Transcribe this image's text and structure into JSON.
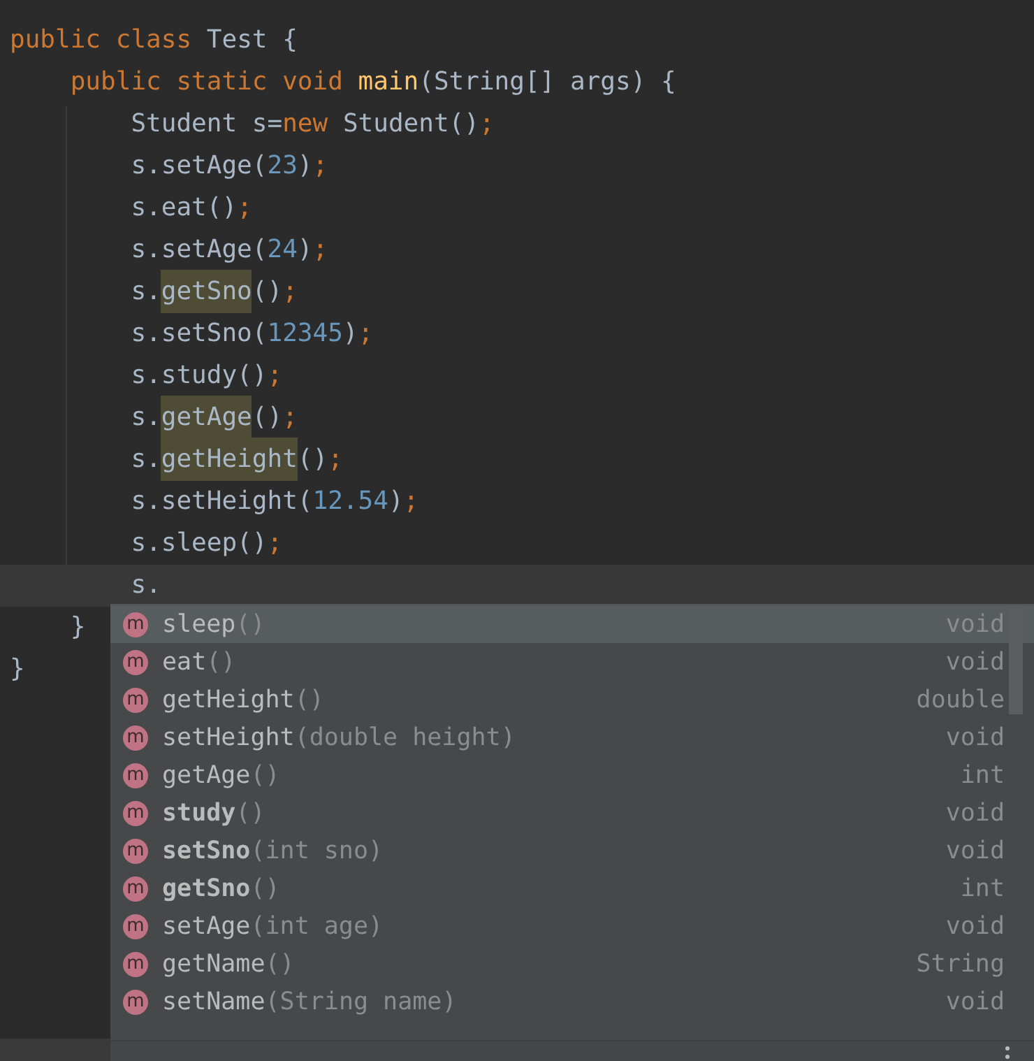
{
  "code_lines": [
    {
      "current": false,
      "tokens": [
        {
          "text": "public class ",
          "kind": "keyword"
        },
        {
          "text": "Test {",
          "kind": "plain"
        }
      ]
    },
    {
      "current": false,
      "tokens": [
        {
          "text": "    public static void ",
          "kind": "keyword"
        },
        {
          "text": "main",
          "kind": "declaration"
        },
        {
          "text": "(String[] args) {",
          "kind": "plain"
        }
      ]
    },
    {
      "current": false,
      "tokens": [
        {
          "text": "        Student s=",
          "kind": "plain"
        },
        {
          "text": "new ",
          "kind": "keyword"
        },
        {
          "text": "Student()",
          "kind": "plain"
        },
        {
          "text": ";",
          "kind": "keyword"
        }
      ]
    },
    {
      "current": false,
      "tokens": [
        {
          "text": "        s.setAge(",
          "kind": "plain"
        },
        {
          "text": "23",
          "kind": "number"
        },
        {
          "text": ")",
          "kind": "plain"
        },
        {
          "text": ";",
          "kind": "keyword"
        }
      ]
    },
    {
      "current": false,
      "tokens": [
        {
          "text": "        s.eat()",
          "kind": "plain"
        },
        {
          "text": ";",
          "kind": "keyword"
        }
      ]
    },
    {
      "current": false,
      "tokens": [
        {
          "text": "        s.setAge(",
          "kind": "plain"
        },
        {
          "text": "24",
          "kind": "number"
        },
        {
          "text": ")",
          "kind": "plain"
        },
        {
          "text": ";",
          "kind": "keyword"
        }
      ]
    },
    {
      "current": false,
      "tokens": [
        {
          "text": "        s.",
          "kind": "plain"
        },
        {
          "text": "getSno",
          "kind": "usage"
        },
        {
          "text": "()",
          "kind": "plain"
        },
        {
          "text": ";",
          "kind": "keyword"
        }
      ]
    },
    {
      "current": false,
      "tokens": [
        {
          "text": "        s.setSno(",
          "kind": "plain"
        },
        {
          "text": "12345",
          "kind": "number"
        },
        {
          "text": ")",
          "kind": "plain"
        },
        {
          "text": ";",
          "kind": "keyword"
        }
      ]
    },
    {
      "current": false,
      "tokens": [
        {
          "text": "        s.study()",
          "kind": "plain"
        },
        {
          "text": ";",
          "kind": "keyword"
        }
      ]
    },
    {
      "current": false,
      "tokens": [
        {
          "text": "        s.",
          "kind": "plain"
        },
        {
          "text": "getAge",
          "kind": "usage"
        },
        {
          "text": "()",
          "kind": "plain"
        },
        {
          "text": ";",
          "kind": "keyword"
        }
      ]
    },
    {
      "current": false,
      "tokens": [
        {
          "text": "        s.",
          "kind": "plain"
        },
        {
          "text": "getHeight",
          "kind": "usage"
        },
        {
          "text": "()",
          "kind": "plain"
        },
        {
          "text": ";",
          "kind": "keyword"
        }
      ]
    },
    {
      "current": false,
      "tokens": [
        {
          "text": "        s.setHeight(",
          "kind": "plain"
        },
        {
          "text": "12.54",
          "kind": "number"
        },
        {
          "text": ")",
          "kind": "plain"
        },
        {
          "text": ";",
          "kind": "keyword"
        }
      ]
    },
    {
      "current": false,
      "tokens": [
        {
          "text": "        s.sleep()",
          "kind": "plain"
        },
        {
          "text": ";",
          "kind": "keyword"
        }
      ]
    },
    {
      "current": true,
      "tokens": [
        {
          "text": "        s.",
          "kind": "plain"
        }
      ]
    },
    {
      "current": false,
      "tokens": [
        {
          "text": "    }",
          "kind": "plain"
        }
      ]
    },
    {
      "current": false,
      "tokens": [
        {
          "text": "}",
          "kind": "plain"
        }
      ]
    }
  ],
  "completion_popup": {
    "items": [
      {
        "icon": "m",
        "name": "sleep",
        "params": "()",
        "type": "void",
        "bold": false,
        "selected": true
      },
      {
        "icon": "m",
        "name": "eat",
        "params": "()",
        "type": "void",
        "bold": false,
        "selected": false
      },
      {
        "icon": "m",
        "name": "getHeight",
        "params": "()",
        "type": "double",
        "bold": false,
        "selected": false
      },
      {
        "icon": "m",
        "name": "setHeight",
        "params": "(double height)",
        "type": "void",
        "bold": false,
        "selected": false
      },
      {
        "icon": "m",
        "name": "getAge",
        "params": "()",
        "type": "int",
        "bold": false,
        "selected": false
      },
      {
        "icon": "m",
        "name": "study",
        "params": "()",
        "type": "void",
        "bold": true,
        "selected": false
      },
      {
        "icon": "m",
        "name": "setSno",
        "params": "(int sno)",
        "type": "void",
        "bold": true,
        "selected": false
      },
      {
        "icon": "m",
        "name": "getSno",
        "params": "()",
        "type": "int",
        "bold": true,
        "selected": false
      },
      {
        "icon": "m",
        "name": "setAge",
        "params": "(int age)",
        "type": "void",
        "bold": false,
        "selected": false
      },
      {
        "icon": "m",
        "name": "getName",
        "params": "()",
        "type": "String",
        "bold": false,
        "selected": false
      },
      {
        "icon": "m",
        "name": "setName",
        "params": "(String name)",
        "type": "void",
        "bold": false,
        "selected": false
      }
    ]
  }
}
